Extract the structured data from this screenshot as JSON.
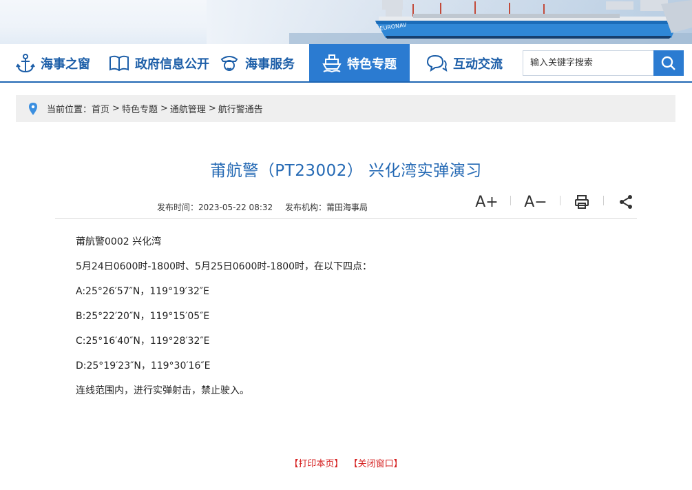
{
  "nav": {
    "items": [
      {
        "label": "海事之窗",
        "icon": "anchor-icon"
      },
      {
        "label": "政府信息公开",
        "icon": "book-icon"
      },
      {
        "label": "海事服务",
        "icon": "officer-icon"
      },
      {
        "label": "特色专题",
        "icon": "ship-icon",
        "active": true
      },
      {
        "label": "互动交流",
        "icon": "chat-icon"
      }
    ],
    "search_placeholder": "输入关键字搜索",
    "active_color": "#2b7bd1",
    "text_color": "#1c5ea8"
  },
  "breadcrumb": {
    "prefix": "当前位置：",
    "items": [
      "首页",
      "特色专题",
      "通航管理",
      "航行警通告"
    ],
    "separator": ">"
  },
  "article": {
    "title": "莆航警（PT23002） 兴化湾实弹演习",
    "publish_time": "发布时间：2023-05-22 08:32",
    "publisher": "发布机构：莆田海事局",
    "tools": {
      "font_up": "A+",
      "font_down": "A−"
    },
    "paragraphs": [
      "莆航警0002  兴化湾",
      "5月24日0600时-1800时、5月25日0600时-1800时，在以下四点：",
      "A:25°26′57″N，119°19′32″E",
      "B:25°22′20″N，119°15′05″E",
      "C:25°16′40″N，119°28′32″E",
      "D:25°19′23″N，119°30′16″E",
      "连线范围内，进行实弹射击，禁止驶入。"
    ]
  },
  "footer": {
    "print_label": "【打印本页】",
    "close_label": "【关闭窗口】",
    "link_color": "#d52020"
  }
}
